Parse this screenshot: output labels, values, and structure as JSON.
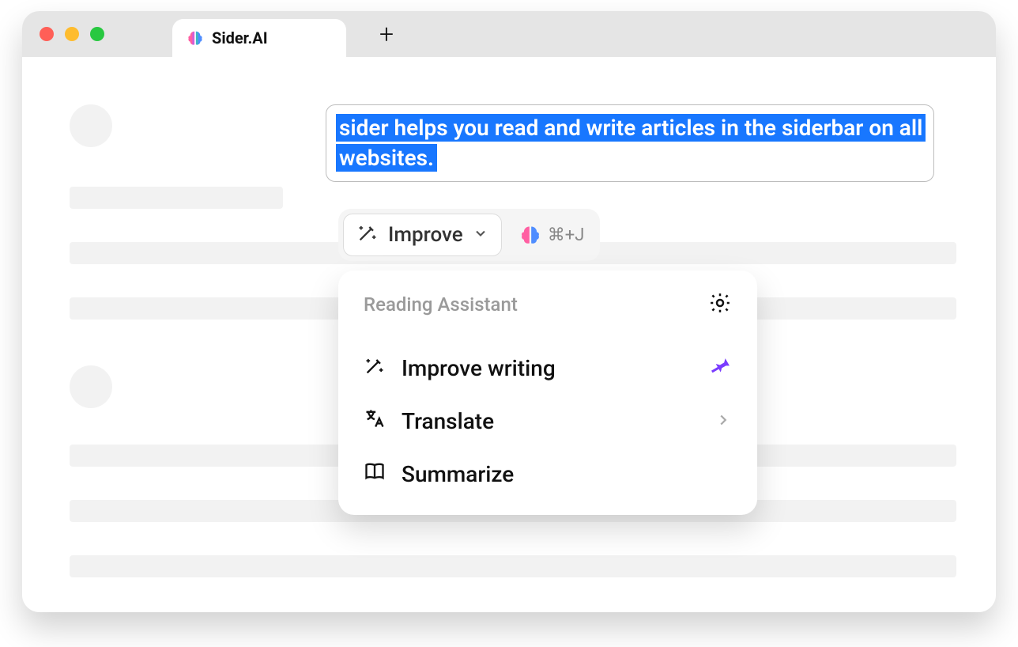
{
  "browser": {
    "tab_title": "Sider.AI"
  },
  "selection_text": "sider helps you read and write articles in the siderbar on all websites.",
  "action_bar": {
    "improve_label": "Improve",
    "shortcut_label": "⌘+J"
  },
  "popup": {
    "title": "Reading Assistant",
    "items": [
      {
        "label": "Improve writing",
        "icon": "wand",
        "pinned": true
      },
      {
        "label": "Translate",
        "icon": "translate",
        "submenu": true
      },
      {
        "label": "Summarize",
        "icon": "book"
      }
    ]
  }
}
